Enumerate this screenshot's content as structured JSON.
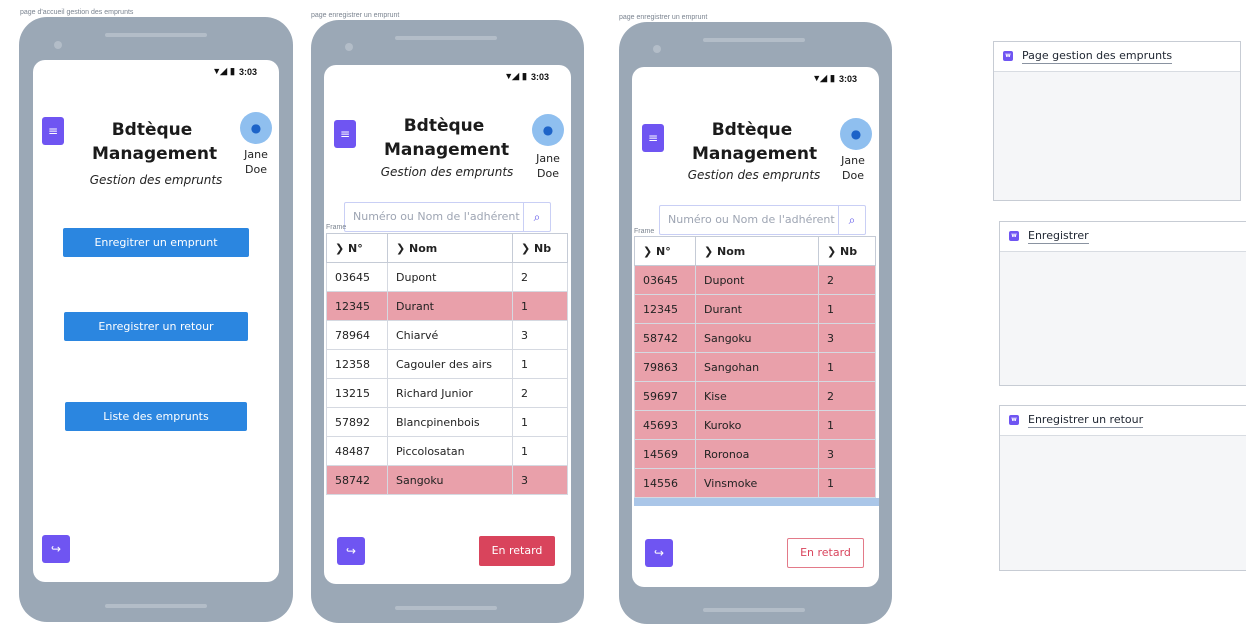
{
  "frame_labels": {
    "home": "page d'accueil gestion des emprunts",
    "register1": "page enregistrer un emprunt",
    "register2": "page enregistrer un emprunt"
  },
  "status": {
    "time": "3:03"
  },
  "app": {
    "title_line1": "Bdtèque",
    "title_line2": "Management",
    "subtitle": "Gestion des emprunts",
    "user_first": "Jane",
    "user_last": "Doe"
  },
  "home": {
    "buttons": [
      "Enregitrer un emprunt",
      "Enregistrer un retour",
      "Liste des emprunts"
    ]
  },
  "search": {
    "placeholder": "Numéro ou Nom de l'adhérent"
  },
  "table_frame_label": "Frame",
  "table_headers": [
    "N°",
    "Nom",
    "Nb"
  ],
  "table1": {
    "rows": [
      {
        "num": "03645",
        "nom": "Dupont",
        "nb": "2",
        "late": false
      },
      {
        "num": "12345",
        "nom": "Durant",
        "nb": "1",
        "late": true
      },
      {
        "num": "78964",
        "nom": "Chiarvé",
        "nb": "3",
        "late": false
      },
      {
        "num": "12358",
        "nom": "Cagouler des airs",
        "nb": "1",
        "late": false
      },
      {
        "num": "13215",
        "nom": "Richard Junior",
        "nb": "2",
        "late": false
      },
      {
        "num": "57892",
        "nom": "Blancpinenbois",
        "nb": "1",
        "late": false
      },
      {
        "num": "48487",
        "nom": "Piccolosatan",
        "nb": "1",
        "late": false
      },
      {
        "num": "58742",
        "nom": "Sangoku",
        "nb": "3",
        "late": true
      }
    ]
  },
  "table2": {
    "rows": [
      {
        "num": "03645",
        "nom": "Dupont",
        "nb": "2",
        "late": true
      },
      {
        "num": "12345",
        "nom": "Durant",
        "nb": "1",
        "late": true
      },
      {
        "num": "58742",
        "nom": "Sangoku",
        "nb": "3",
        "late": true
      },
      {
        "num": "79863",
        "nom": "Sangohan",
        "nb": "1",
        "late": true
      },
      {
        "num": "59697",
        "nom": "Kise",
        "nb": "2",
        "late": true
      },
      {
        "num": "45693",
        "nom": "Kuroko",
        "nb": "1",
        "late": true
      },
      {
        "num": "14569",
        "nom": "Roronoa",
        "nb": "3",
        "late": true
      },
      {
        "num": "14556",
        "nom": "Vinsmoke",
        "nb": "1",
        "late": true
      }
    ]
  },
  "late_button": "En retard",
  "panels": [
    "Page gestion des emprunts",
    "Enregistrer",
    "Enregistrer un retour"
  ],
  "colors": {
    "accent_purple": "#6f55f2",
    "button_blue": "#2b86e0",
    "late_row": "#e9a0aa",
    "late_button": "#d9445c"
  }
}
